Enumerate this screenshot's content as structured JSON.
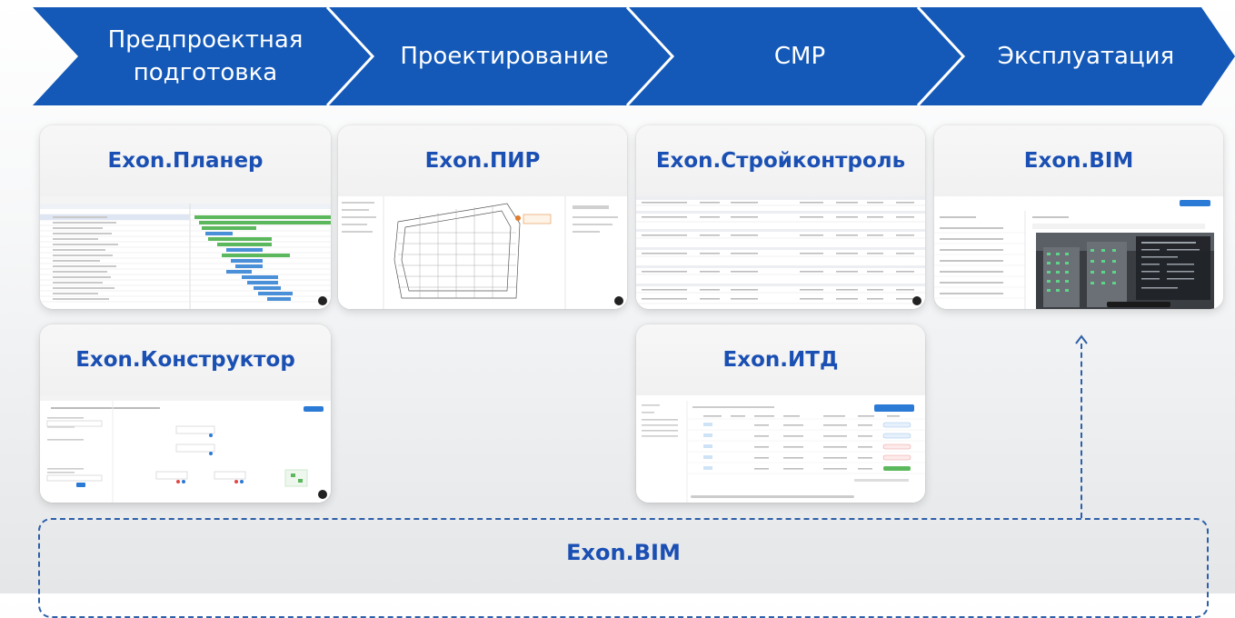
{
  "phases": [
    {
      "label": "Предпроектная подготовка"
    },
    {
      "label": "Проектирование"
    },
    {
      "label": "СМР"
    },
    {
      "label": "Эксплуатация"
    }
  ],
  "products": {
    "planer": "Exon.Планер",
    "pir": "Exon.ПИР",
    "stroykontrol": "Exon.Стройконтроль",
    "bim_top": "Exon.BIM",
    "konstruktor": "Exon.Конструктор",
    "itd": "Exon.ИТД",
    "bim_bottom": "Exon.BIM"
  },
  "colors": {
    "chevron": "#1459b8",
    "product_text": "#1a4fb3",
    "dashed": "#2d5fa8"
  }
}
